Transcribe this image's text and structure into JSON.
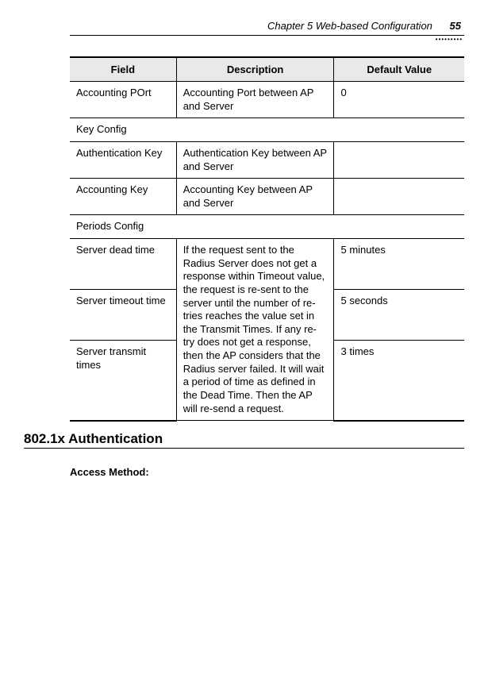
{
  "header": {
    "chapter": "Chapter 5 Web-based Configuration",
    "page": "55"
  },
  "table": {
    "headers": {
      "field": "Field",
      "description": "Description",
      "default": "Default Value"
    },
    "row_acct_port": {
      "field": "Accounting POrt",
      "desc": "Accounting Port between AP and Server",
      "default": "0"
    },
    "sec_key": "Key Config",
    "row_auth_key": {
      "field": "Authentication Key",
      "desc": "Authentication Key between AP and Server",
      "default": ""
    },
    "row_acct_key": {
      "field": "Accounting Key",
      "desc": "Accounting Key between AP and Server",
      "default": ""
    },
    "sec_periods": "Periods Config",
    "row_dead": {
      "field": "Server dead time",
      "default": "5 minutes"
    },
    "row_timeout": {
      "field": "Server timeout time",
      "default": "5 seconds"
    },
    "row_transmit": {
      "field": "Server transmit times",
      "default": "3 times"
    },
    "big_desc": "If the request sent to the Radius Server does not get a response within Timeout value, the request is re-sent to the server until the number of re-tries reaches the value set in the Transmit Times. If any re-try does not get a response, then the AP considers that the Radius server failed. It will wait a period of time as defined in the Dead Time. Then the AP will re-send a request."
  },
  "section": {
    "heading": "802.1x Authentication",
    "sub": "Access Method:"
  }
}
